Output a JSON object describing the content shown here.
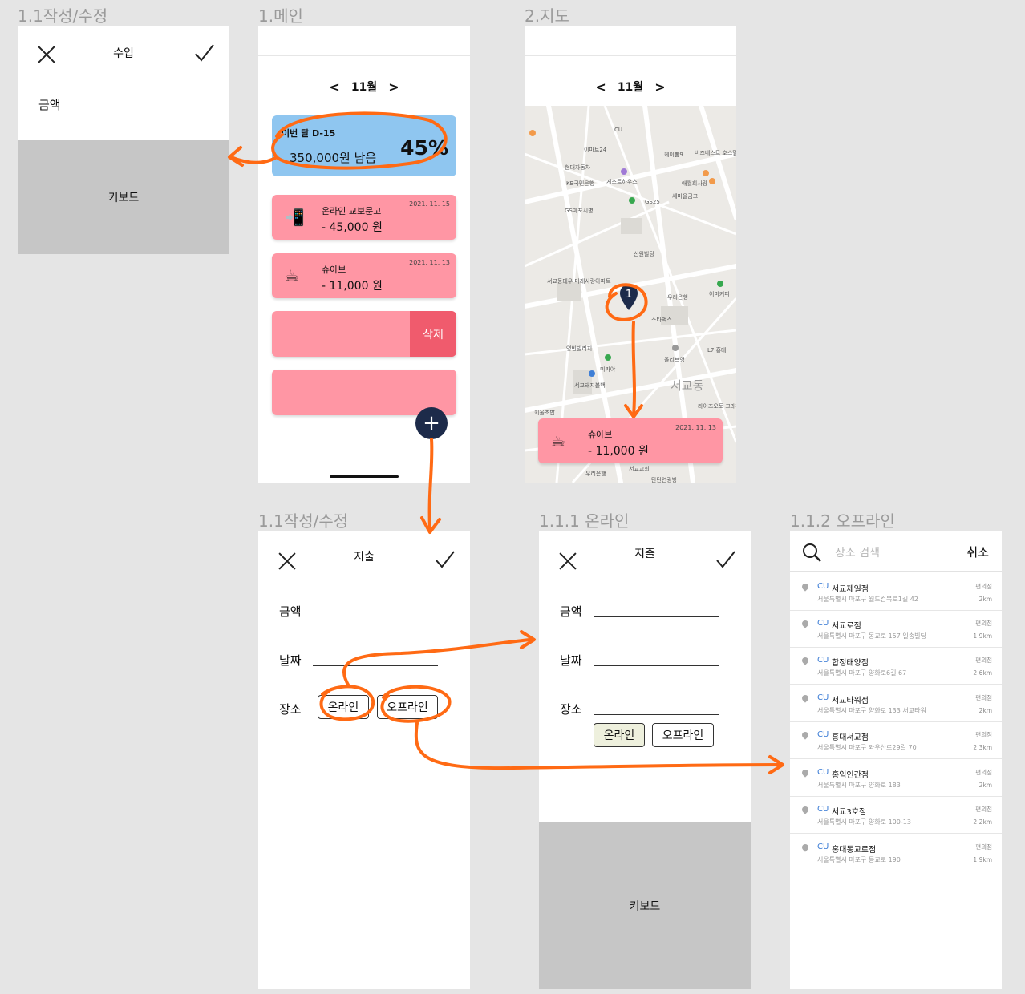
{
  "frame_labels": {
    "income_edit": "1.1작성/수정",
    "main": "1.메인",
    "map": "2.지도",
    "expense_edit": "1.1작성/수정",
    "online": "1.1.1 온라인",
    "offline": "1.1.2 오프라인"
  },
  "income_edit": {
    "title": "수입",
    "amount_label": "금액",
    "keyboard_label": "키보드"
  },
  "main": {
    "month": "11월",
    "budget": {
      "dday": "이번 달 D-15",
      "remaining": "350,000원 남음",
      "percent": "45%"
    },
    "transactions": [
      {
        "icon": "📲",
        "name": "온라인 교보문고",
        "amount": "- 45,000 원",
        "date": "2021. 11. 15"
      },
      {
        "icon": "☕",
        "name": "슈아브",
        "amount": "- 11,000 원",
        "date": "2021. 11. 13"
      }
    ],
    "delete_label": "삭제",
    "fab_label": "+"
  },
  "map": {
    "month": "11월",
    "pin_number": "1",
    "labels": [
      "현대자동차",
      "KB국민은행",
      "게스트하우스",
      "GS마포시병",
      "우리은행",
      "스타벅스",
      "신원빌딩",
      "이마트24",
      "케이뽐9",
      "버즈네스트 호스텔",
      "애월회사랑",
      "세마을금고",
      "GS25",
      "CU",
      "서교동대우 미래사랑아파트",
      "서교동",
      "이미커피",
      "영빈빌리지",
      "미카야",
      "서교돼지볼백",
      "올리브영",
      "L7 홍대",
      "라이즈오토 그래피컬렉션",
      "서교교회",
      "탄탄연광방",
      "키울초밥",
      "우리은행"
    ],
    "card": {
      "icon": "☕",
      "name": "슈아브",
      "amount": "- 11,000 원",
      "date": "2021. 11. 13"
    }
  },
  "expense_edit": {
    "title": "지출",
    "amount_label": "금액",
    "date_label": "날짜",
    "place_label": "장소",
    "online_btn": "온라인",
    "offline_btn": "오프라인"
  },
  "online": {
    "title": "지출",
    "amount_label": "금액",
    "date_label": "날짜",
    "place_label": "장소",
    "online_btn": "온라인",
    "offline_btn": "오프라인",
    "keyboard_label": "키보드"
  },
  "offline": {
    "search_placeholder": "장소 검색",
    "cancel_label": "취소",
    "results": [
      {
        "brand": "CU",
        "name": "서교제일점",
        "address": "서울특별시 마포구 월드컵북로1길 42",
        "category": "편의점",
        "distance": "2km"
      },
      {
        "brand": "CU",
        "name": "서교로점",
        "address": "서울특별시 마포구 동교로 157 일송빌딩",
        "category": "편의점",
        "distance": "1.9km"
      },
      {
        "brand": "CU",
        "name": "합정태양점",
        "address": "서울특별시 마포구 양화로6길 67",
        "category": "편의점",
        "distance": "2.6km"
      },
      {
        "brand": "CU",
        "name": "서교타워점",
        "address": "서울특별시 마포구 양화로 133 서교타워",
        "category": "편의점",
        "distance": "2km"
      },
      {
        "brand": "CU",
        "name": "홍대서교점",
        "address": "서울특별시 마포구 와우산로29길 70",
        "category": "편의점",
        "distance": "2.3km"
      },
      {
        "brand": "CU",
        "name": "홍익인간점",
        "address": "서울특별시 마포구 양화로 183",
        "category": "편의점",
        "distance": "2km"
      },
      {
        "brand": "CU",
        "name": "서교3호점",
        "address": "서울특별시 마포구 양화로 100-13",
        "category": "편의점",
        "distance": "2.2km"
      },
      {
        "brand": "CU",
        "name": "홍대동교로점",
        "address": "서울특별시 마포구 동교로 190",
        "category": "편의점",
        "distance": "1.9km"
      }
    ]
  },
  "colors": {
    "budget_card": "#8fc6f0",
    "txn_card": "#ff96a4",
    "delete": "#f05b6d",
    "fab": "#1d2b4a",
    "annotation": "#ff6a14",
    "keyboard": "#c6c6c6"
  }
}
